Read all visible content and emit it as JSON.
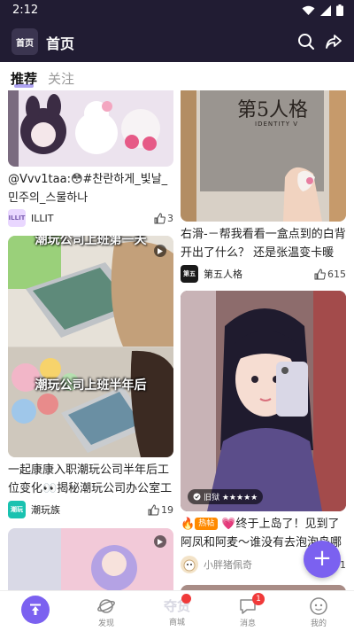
{
  "status": {
    "time": "2:12"
  },
  "header": {
    "logo_text": "首页",
    "title": "首页"
  },
  "tabs": [
    {
      "label": "推荐",
      "active": true
    },
    {
      "label": "关注",
      "active": false
    }
  ],
  "cards": [
    {
      "caption": "@Vvv1taa:😳#찬란하게_빛날_민주의_스물하나#LuckyBunny_MINJ...",
      "author": "ILLIT",
      "likes": "3",
      "avatar_text": "ILLIT",
      "avatar_color": "#e9d7ff"
    },
    {
      "caption": "右滑-－帮我看看一盒点到的白背开出了什么？ 还是张温变卡暖😍...",
      "author": "第五人格",
      "likes": "615",
      "avatar_text": "第五",
      "avatar_color": "#1a1a1a",
      "image_text": "第5人格",
      "image_subtext": "IDENTITY V"
    },
    {
      "overlay_top": "潮玩公司上班第一天",
      "overlay_bottom": "潮玩公司上班半年后",
      "caption": "一起康康入职潮玩公司半年后工位变化👀揭秘潮玩公司办公室工位...",
      "author": "潮玩族",
      "likes": "19",
      "avatar_text": "潮玩",
      "avatar_color": "#19c2b0"
    },
    {
      "hot_badge": "热帖",
      "chip": "旧狱 ★★★★★",
      "caption": "💗终于上岛了！见到了阿凤和阿麦～谁没有去泡泡岛哪啊...",
      "author": "小胖猪佩奇",
      "likes": "1",
      "avatar_text": "",
      "avatar_color": "#f3e3c8"
    },
    {
      "caption": ""
    },
    {
      "caption": ""
    }
  ],
  "fab": {
    "label": "+"
  },
  "bottomnav": [
    {
      "label": "",
      "icon": "home-icon"
    },
    {
      "label": "发现",
      "icon": "planet-icon"
    },
    {
      "label": "商城",
      "icon": "mall-icon",
      "watermark": "夺货",
      "badge": ""
    },
    {
      "label": "消息",
      "icon": "message-icon",
      "badge": "1"
    },
    {
      "label": "我的",
      "icon": "profile-icon"
    }
  ]
}
